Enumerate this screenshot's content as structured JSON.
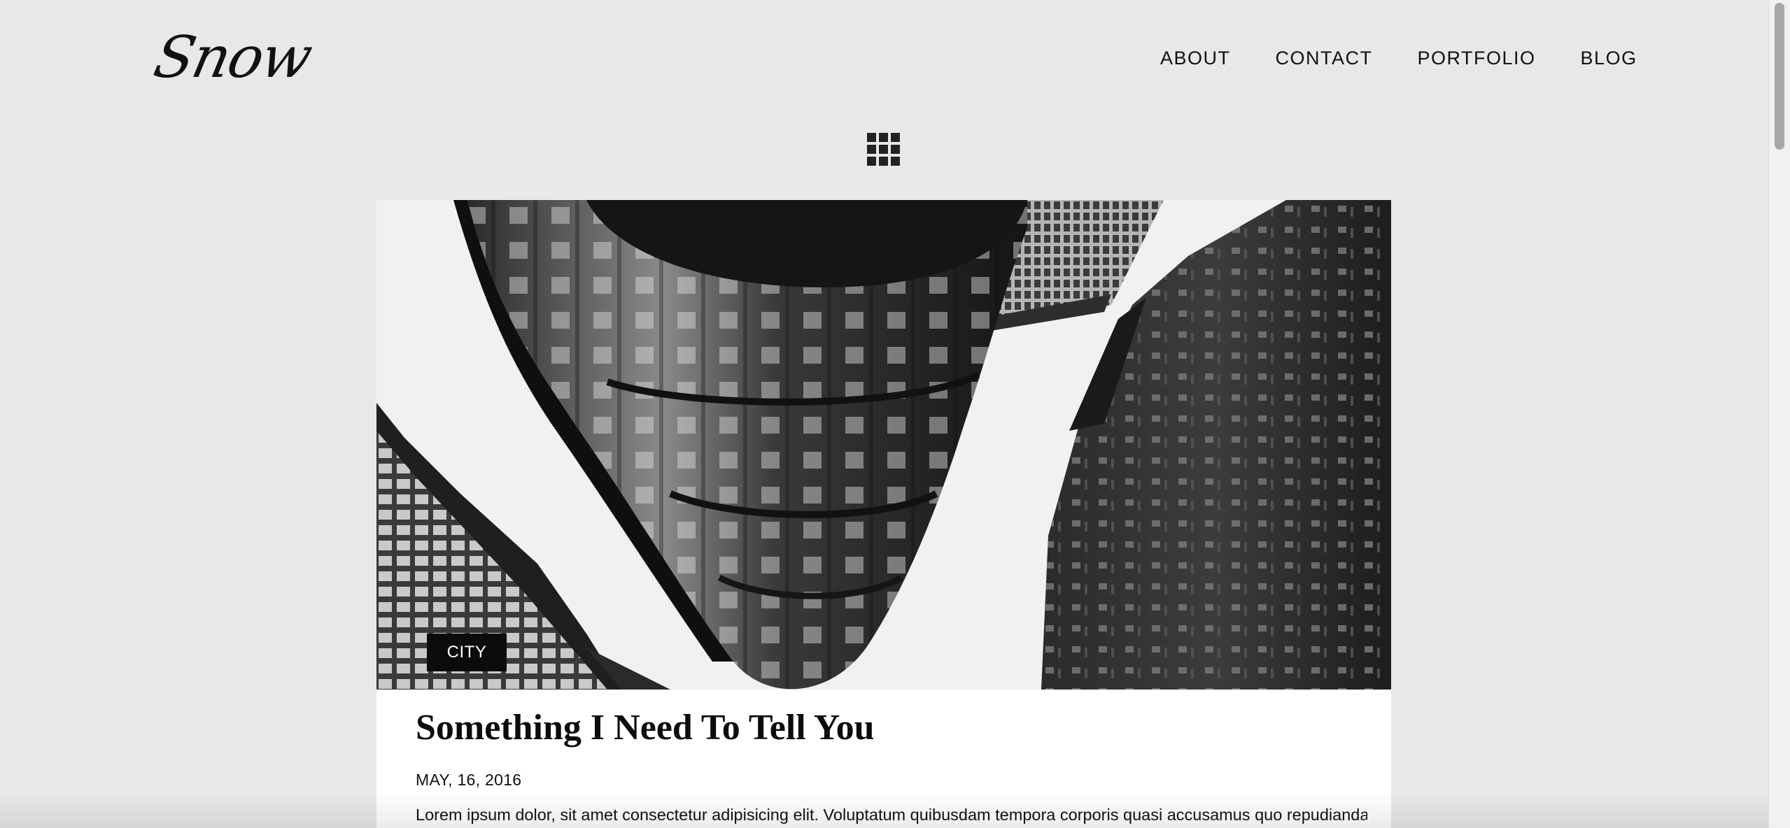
{
  "header": {
    "logo_text": "Snow",
    "nav": [
      "ABOUT",
      "CONTACT",
      "PORTFOLIO",
      "BLOG"
    ]
  },
  "toolbar": {
    "grid_icon": "grid-icon"
  },
  "post": {
    "category": "CITY",
    "title": "Something I Need To Tell You",
    "date": "MAY, 16, 2016",
    "excerpt": "Lorem ipsum dolor, sit amet consectetur adipisicing elit. Voluptatum quibusdam tempora corporis quasi accusamus quo repudiandae",
    "image": "black-and-white upward view of city buildings"
  },
  "colors": {
    "background": "#e8e8e8",
    "card": "#ffffff",
    "text": "#111111",
    "badge": "#0b0b0b"
  }
}
